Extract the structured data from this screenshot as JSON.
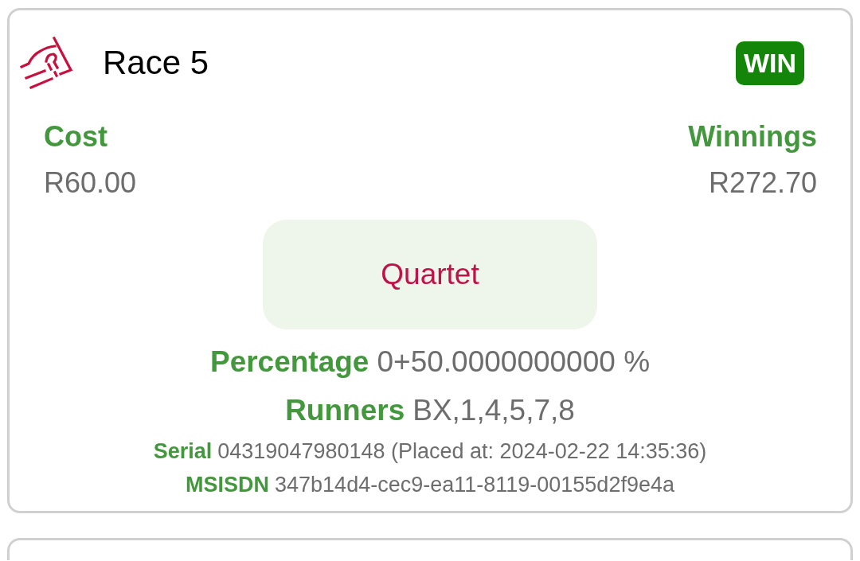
{
  "card": {
    "title": "Race 5",
    "badge": {
      "label": "WIN",
      "kind": "win"
    },
    "cost": {
      "label": "Cost",
      "value": "R60.00"
    },
    "winnings": {
      "label": "Winnings",
      "value": "R272.70"
    },
    "bet_type": "Quartet",
    "details": [
      {
        "label": "Percentage",
        "value": "0+50.0000000000 %",
        "kind": "main"
      },
      {
        "label": "Runners",
        "value": "BX,1,4,5,7,8",
        "kind": "main"
      },
      {
        "label": "Serial",
        "value": "04319047980148 (Placed at: 2024-02-22 14:35:36)",
        "kind": "meta"
      },
      {
        "label": "MSISDN",
        "value": "347b14d4-cec9-ea11-8119-00155d2f9e4a",
        "kind": "meta"
      }
    ]
  }
}
